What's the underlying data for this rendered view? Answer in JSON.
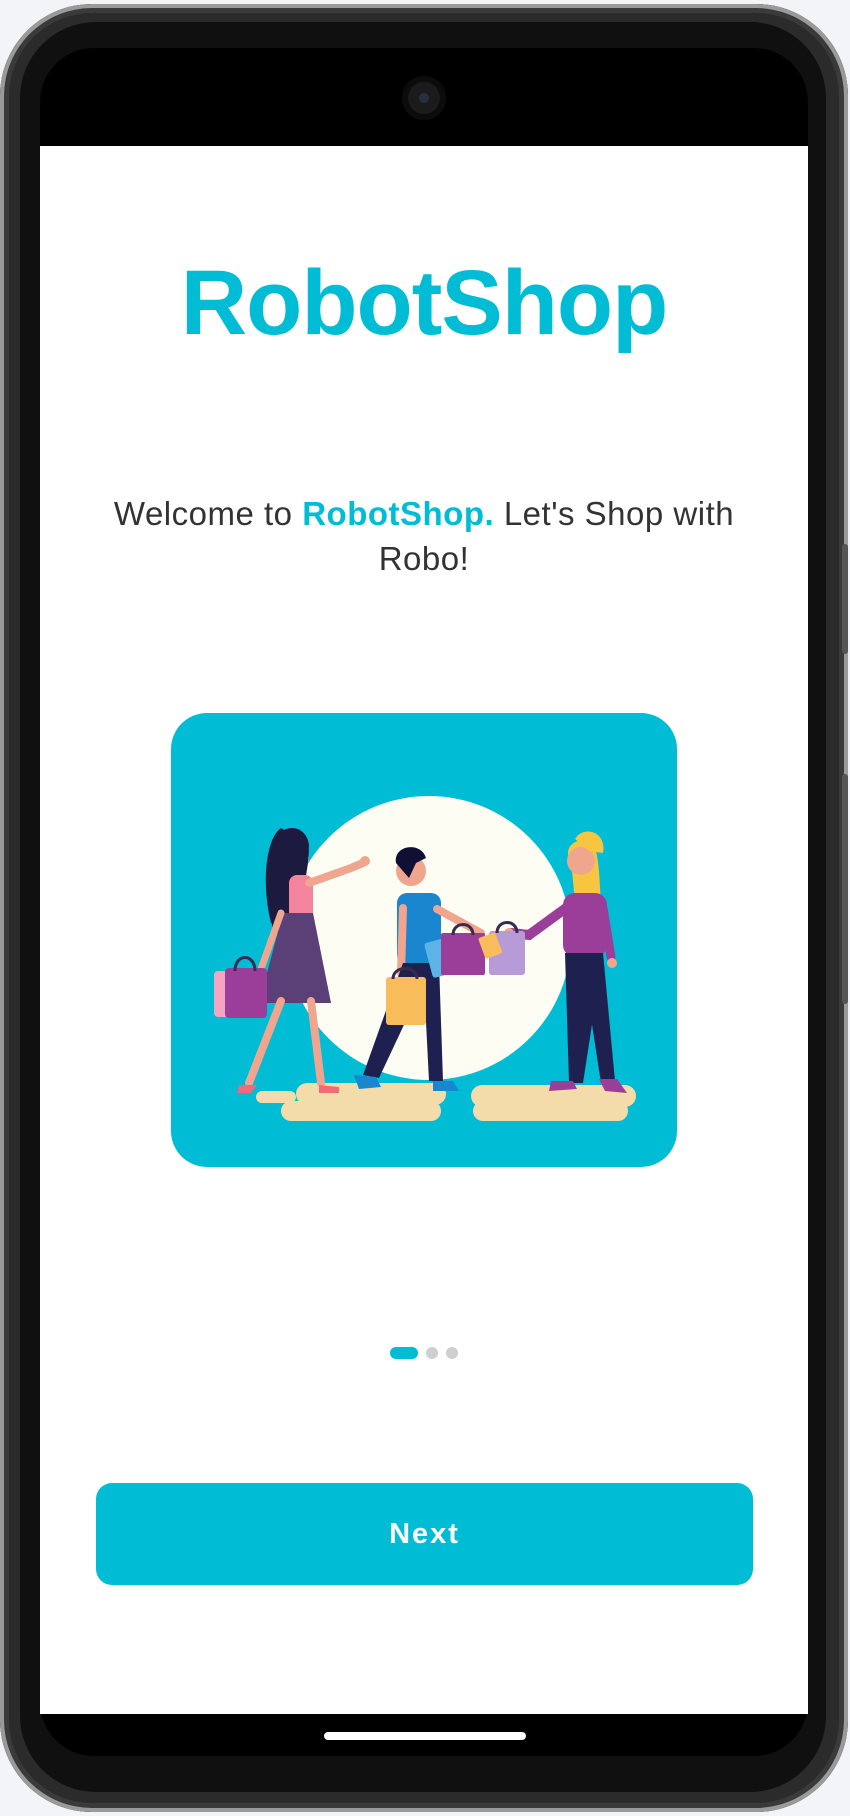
{
  "app": {
    "title": "RobotShop"
  },
  "welcome": {
    "prefix": "Welcome to ",
    "brand": "RobotShop.",
    "suffix": " Let's Shop with Robo!"
  },
  "illustration": {
    "icon": "shopping-people-illustration"
  },
  "pager": {
    "current_page": 1,
    "total_pages": 3
  },
  "actions": {
    "next_label": "Next"
  },
  "colors": {
    "accent": "#00bcd4",
    "text": "#333333",
    "background": "#ffffff"
  }
}
